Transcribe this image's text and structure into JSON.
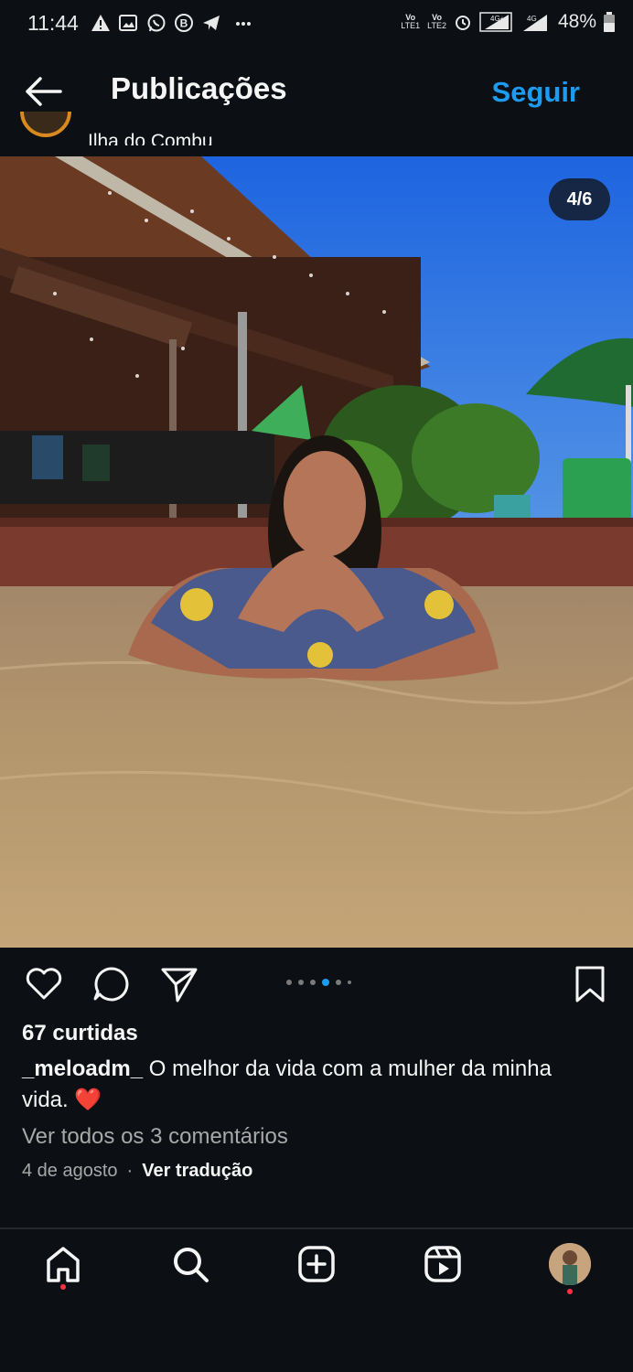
{
  "status_bar": {
    "time": "11:44",
    "battery": "48%",
    "network_labels": [
      "Vo LTE1",
      "Vo LTE2",
      "4G+",
      "4G"
    ],
    "left_icons": [
      "warning-icon",
      "gallery-icon",
      "whatsapp-icon",
      "b-app-icon",
      "telegram-icon",
      "more-dots-icon"
    ],
    "right_icons": [
      "alarm-icon",
      "signal-icon",
      "battery-icon"
    ]
  },
  "header": {
    "title": "Publicações",
    "follow_label": "Seguir",
    "location": "Ilha do Combu"
  },
  "post": {
    "image_counter": "4/6",
    "carousel_total": 6,
    "carousel_active": 4,
    "likes": "67 curtidas",
    "caption_user": "_meloadm_",
    "caption_text": " O melhor da vida com a mulher da minha vida. ",
    "caption_emoji": "❤️",
    "view_comments": "Ver todos os 3 comentários",
    "date": "4 de agosto",
    "separator": "·",
    "translate": "Ver tradução"
  },
  "colors": {
    "background": "#0c1014",
    "accent": "#1d9bf0",
    "notification": "#ff3040"
  },
  "bottom_nav": [
    "home-icon",
    "search-icon",
    "create-icon",
    "reels-icon",
    "profile-avatar"
  ]
}
